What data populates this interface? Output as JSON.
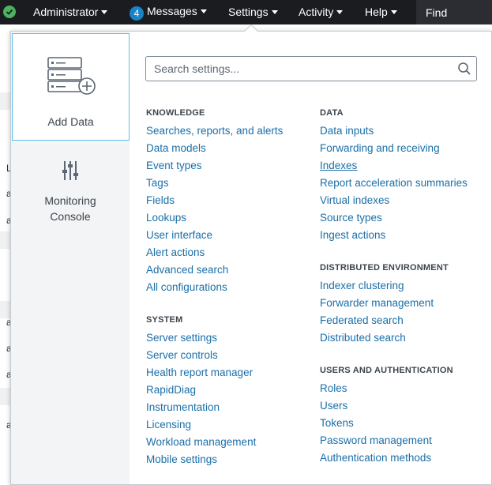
{
  "topbar": {
    "admin_label": "Administrator",
    "messages_count": "4",
    "messages_label": "Messages",
    "settings_label": "Settings",
    "activity_label": "Activity",
    "help_label": "Help",
    "find_label": "Find"
  },
  "background": {
    "letters": [
      "L",
      "a",
      "a",
      "a",
      "a",
      "a",
      "a"
    ]
  },
  "side_panel": {
    "add_data_label": "Add Data",
    "monitoring_line1": "Monitoring",
    "monitoring_line2": "Console"
  },
  "search": {
    "placeholder": "Search settings..."
  },
  "knowledge": {
    "heading": "KNOWLEDGE",
    "items": [
      "Searches, reports, and alerts",
      "Data models",
      "Event types",
      "Tags",
      "Fields",
      "Lookups",
      "User interface",
      "Alert actions",
      "Advanced search",
      "All configurations"
    ]
  },
  "system": {
    "heading": "SYSTEM",
    "items": [
      "Server settings",
      "Server controls",
      "Health report manager",
      "RapidDiag",
      "Instrumentation",
      "Licensing",
      "Workload management",
      "Mobile settings"
    ]
  },
  "data": {
    "heading": "DATA",
    "items": [
      "Data inputs",
      "Forwarding and receiving",
      "Indexes",
      "Report acceleration summaries",
      "Virtual indexes",
      "Source types",
      "Ingest actions"
    ]
  },
  "distributed": {
    "heading": "DISTRIBUTED ENVIRONMENT",
    "items": [
      "Indexer clustering",
      "Forwarder management",
      "Federated search",
      "Distributed search"
    ]
  },
  "users_auth": {
    "heading": "USERS AND AUTHENTICATION",
    "items": [
      "Roles",
      "Users",
      "Tokens",
      "Password management",
      "Authentication methods"
    ]
  },
  "colors": {
    "topbar_bg": "#1a1c20",
    "link": "#1a6fa8",
    "status_green": "#4bb35f",
    "badge_blue": "#1a82c7"
  }
}
